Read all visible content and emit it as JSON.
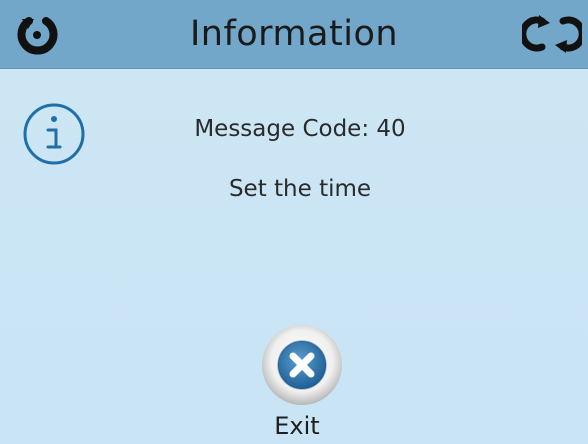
{
  "header": {
    "title": "Information",
    "left_icon": "home-back-icon",
    "right_icon": "refresh-icon"
  },
  "message": {
    "icon": "info-icon",
    "code_line": "Message Code: 40",
    "text": "Set the time"
  },
  "actions": {
    "exit_label": "Exit",
    "exit_icon": "close-icon"
  },
  "colors": {
    "header_bg": "#72a7c9",
    "screen_bg": "#cde6f4",
    "accent": "#1f6fa8"
  }
}
